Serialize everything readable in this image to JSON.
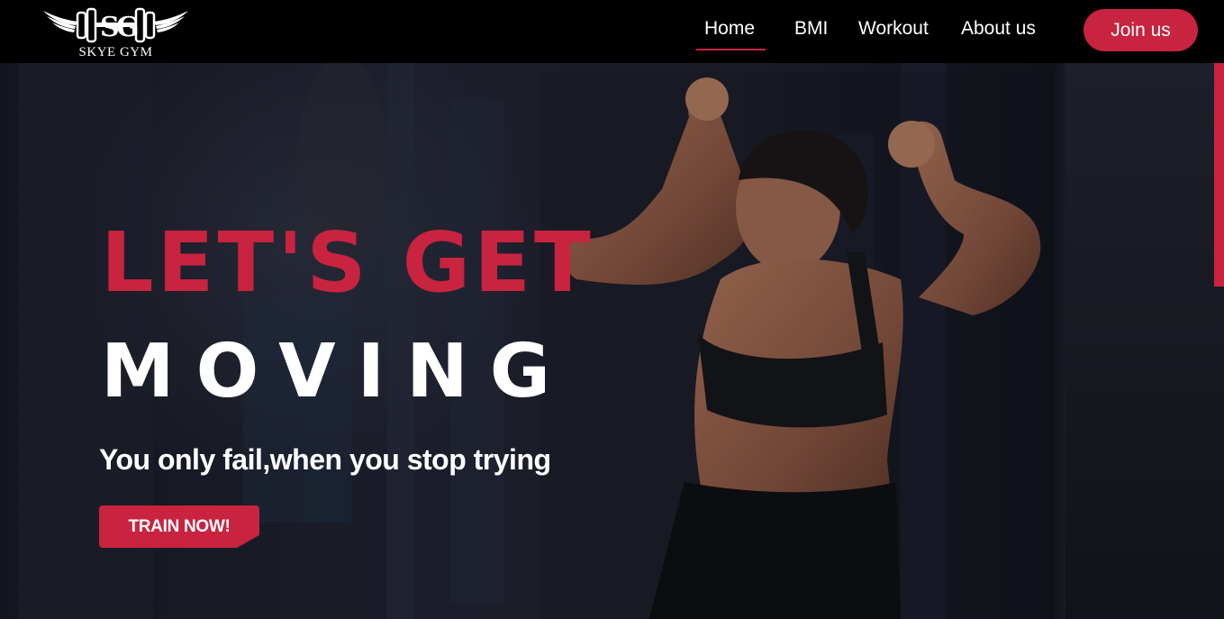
{
  "navbar": {
    "logo_text": "SKYE GYM",
    "links": [
      {
        "label": "Home",
        "active": true
      },
      {
        "label": "BMI",
        "active": false
      },
      {
        "label": "Workout",
        "active": false
      },
      {
        "label": "About us",
        "active": false
      }
    ],
    "join_label": "Join us"
  },
  "hero": {
    "title_line1": "LET'S GET",
    "title_line2": "MOVING",
    "tagline": "You only fail,when you stop trying",
    "cta_label": "TRAIN NOW!"
  },
  "colors": {
    "accent": "#c8233f",
    "navbar_bg": "#000000",
    "hero_bg": "#1a1c26",
    "text": "#ffffff"
  },
  "icons": {
    "logo": "winged-dumbbell-logo"
  }
}
